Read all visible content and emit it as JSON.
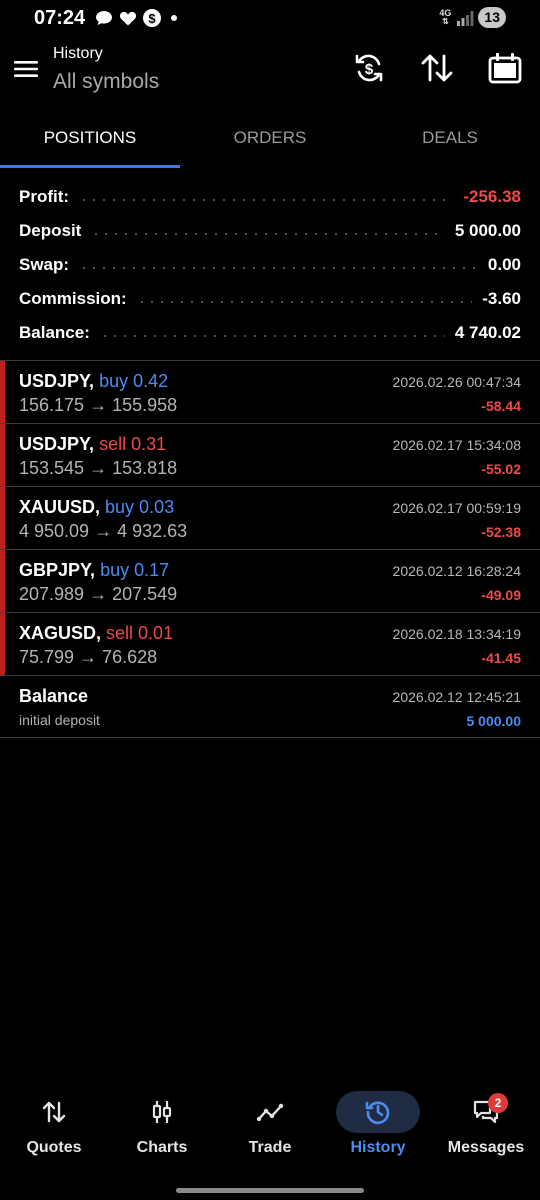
{
  "status_bar": {
    "time": "07:24",
    "network": "4G",
    "battery": "13",
    "icons": [
      "chat-bubble-icon",
      "heart-icon",
      "dollar-circle-icon",
      "dot-icon",
      "signal-icon"
    ]
  },
  "header": {
    "subtitle": "History",
    "title": "All symbols",
    "actions": [
      "sync-currency-icon",
      "sort-icon",
      "calendar-icon"
    ]
  },
  "tabs": [
    {
      "label": "POSITIONS",
      "active": true
    },
    {
      "label": "ORDERS",
      "active": false
    },
    {
      "label": "DEALS",
      "active": false
    }
  ],
  "summary": [
    {
      "label": "Profit:",
      "value": "-256.38",
      "negative": true
    },
    {
      "label": "Deposit",
      "value": "5 000.00",
      "negative": false
    },
    {
      "label": "Swap:",
      "value": "0.00",
      "negative": false
    },
    {
      "label": "Commission:",
      "value": "-3.60",
      "negative": false
    },
    {
      "label": "Balance:",
      "value": "4 740.02",
      "negative": false
    }
  ],
  "positions": [
    {
      "symbol": "USDJPY,",
      "side": "buy 0.42",
      "side_type": "buy",
      "prices": "156.175 → 155.958",
      "time": "2026.02.26 00:47:34",
      "profit": "-58.44"
    },
    {
      "symbol": "USDJPY,",
      "side": "sell 0.31",
      "side_type": "sell",
      "prices": "153.545 → 153.818",
      "time": "2026.02.17 15:34:08",
      "profit": "-55.02"
    },
    {
      "symbol": "XAUUSD,",
      "side": "buy 0.03",
      "side_type": "buy",
      "prices": "4 950.09 → 4 932.63",
      "time": "2026.02.17 00:59:19",
      "profit": "-52.38"
    },
    {
      "symbol": "GBPJPY,",
      "side": "buy 0.17",
      "side_type": "buy",
      "prices": "207.989 → 207.549",
      "time": "2026.02.12 16:28:24",
      "profit": "-49.09"
    },
    {
      "symbol": "XAGUSD,",
      "side": "sell 0.01",
      "side_type": "sell",
      "prices": "75.799 → 76.628",
      "time": "2026.02.18 13:34:19",
      "profit": "-41.45"
    }
  ],
  "balance_entry": {
    "title": "Balance",
    "note": "initial deposit",
    "time": "2026.02.12 12:45:21",
    "amount": "5 000.00"
  },
  "bottom_nav": [
    {
      "label": "Quotes",
      "icon": "quotes-arrows-icon",
      "active": false
    },
    {
      "label": "Charts",
      "icon": "candles-icon",
      "active": false
    },
    {
      "label": "Trade",
      "icon": "trade-line-icon",
      "active": false
    },
    {
      "label": "History",
      "icon": "history-clock-icon",
      "active": true
    },
    {
      "label": "Messages",
      "icon": "messages-icon",
      "active": false,
      "badge": "2"
    }
  ],
  "colors": {
    "accent": "#4d8bf0",
    "negative": "#ee4a4a",
    "loss_marker": "#c01e1e",
    "background": "#000000"
  }
}
